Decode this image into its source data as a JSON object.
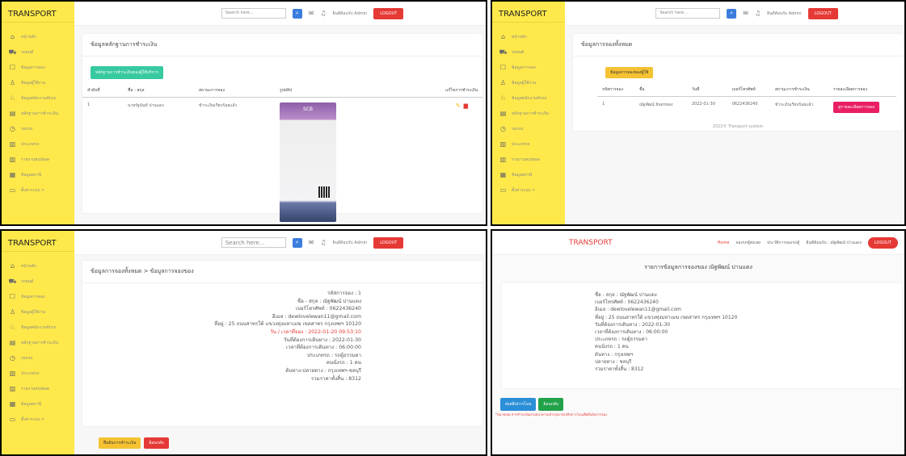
{
  "brand": "TRANSPORT",
  "sidebar_items": [
    {
      "icon": "home-icon",
      "glyph": "⌂",
      "label": "หน้าหลัก"
    },
    {
      "icon": "car-icon",
      "glyph": "⛟",
      "label": "รถยนต์"
    },
    {
      "icon": "booking-icon",
      "glyph": "☐",
      "label": "ข้อมูลการจอง"
    },
    {
      "icon": "user-icon",
      "glyph": "♙",
      "label": "ข้อมูลผู้ใช้งาน"
    },
    {
      "icon": "users-icon",
      "glyph": "♘",
      "label": "ข้อมูลพนักงานขับรถ"
    },
    {
      "icon": "payment-icon",
      "glyph": "▤",
      "label": "หลักฐานการชำระเงิน"
    },
    {
      "icon": "clock-icon",
      "glyph": "◷",
      "label": "รอบรถ"
    },
    {
      "icon": "doc-icon",
      "glyph": "▥",
      "label": "ประเภทรถ"
    },
    {
      "icon": "report-icon",
      "glyph": "▥",
      "label": "รายงานสรุปยอด"
    },
    {
      "icon": "grid-icon",
      "glyph": "▦",
      "label": "ข้อมูลสถานี"
    },
    {
      "icon": "folder-icon",
      "glyph": "▭",
      "label": "ตั้งค่าระบบ  >"
    }
  ],
  "topbar": {
    "search_placeholder": "Search here...",
    "user": "ยินดีต้อนรับ Admin",
    "logout": "LOGOUT"
  },
  "panel1": {
    "title": "ข้อมูลหลักฐานการชำระเงิน",
    "add_button": "หลักฐานการชำระเงินของผู้ใช้บริการ",
    "headers": [
      "ลำดับที่",
      "ชื่อ - สกุล",
      "สถานะการจอง",
      "รูปสลิป",
      "แก้ไขการชำระเงิน"
    ],
    "row": {
      "no": "1",
      "name": "นายรัฐนันท์ ปานแดง",
      "status": "ชำระเงินเรียบร้อยแล้ว",
      "slip_bank": "SCB"
    }
  },
  "panel2": {
    "title": "ข้อมูลการจองทั้งหมด",
    "filter_button": "ข้อมูลการจองของผู้ใช้",
    "headers": [
      "รหัสการจอง",
      "ชื่อ",
      "วันที่",
      "เบอร์โทรศัพท์",
      "สถานะการชำระเงิน",
      "รายละเอียดการจอง"
    ],
    "row": {
      "id": "1",
      "name": "ณัฐพัฒน์ อินทรทอง",
      "date": "2022-01-30",
      "phone": "0622436240",
      "status": "ชำระเงินเรียบร้อยแล้ว",
      "detail_button": "ดูรายละเอียดการจอง"
    },
    "footer": "2022© Transport system"
  },
  "panel3": {
    "breadcrumb": "ข้อมูลการจองทั้งหมด > ข้อมูลการจองของ",
    "lines": [
      "รหัสการจอง : 1",
      "ชื่อ - สกุล : ณัฐพัฒน์ ปานแดง",
      "เบอร์โทรศัพท์ : 0622436240",
      "อีเมล : dewlovelewan11@gmail.com",
      "ที่อยู่ : 25 ถนนสาทรใต้ แขวงทุ่งมหาเมฆ เขตสาทร กรุงเทพฯ 10120",
      "วัน / เวลาที่จอง : 2022-01-20 09:53:10",
      "วันที่ต้องการเดินทาง : 2022-01-30",
      "เวลาที่ต้องการเดินทาง : 06:00:00",
      "ประเภทรถ : รถตู้ธรรมดา",
      "คนนั่งรถ : 1 คน",
      "ต้นทาง-ปลายทาง : กรุงเทพฯ-ชลบุรี",
      "รวมราคาทั้งสิ้น : 8312"
    ],
    "confirm_button": "ยืนยันการชำระเงิน",
    "back_button": "ย้อนกลับ"
  },
  "panel4": {
    "brand": "TRANSPORT",
    "nav": [
      "Home",
      "จองรถตู้ส่งเลย",
      "ประวัติการจองรถตู้",
      "ยินดีต้อนรับ : ณัฐพัฒน์ ปานแดง"
    ],
    "logout": "LOGOUT",
    "heading": "รายการข้อมูลการจองของ ณัฐพัฒน์ ปานแดง",
    "lines": [
      "ชื่อ - สกุล : ณัฐพัฒน์ ปานแดง",
      "เบอร์โทรศัพท์ : 0622436240",
      "อีเมล : dewlovelewan11@gmail.com",
      "ที่อยู่ : 25 ถนนสาทรใต้ แขวงทุ่งมหาเมฆ เขตสาทร กรุงเทพฯ 10120",
      "วันที่ต้องการเดินทาง : 2022-01-30",
      "เวลาที่ต้องการเดินทาง : 06:00:00",
      "ประเภทรถ : รถตู้ธรรมดา",
      "คนนั่งรถ : 1 คน",
      "ต้นทาง : กรุงเทพฯ",
      "ปลายทาง : ชลบุรี",
      "รวมราคาทั้งสิ้น : 8312"
    ],
    "slip_button": "ส่งสลิปการโอน",
    "back_button": "ย้อนกลับ",
    "note": "*หมายเหตุ หากชำระเงินผ่านธนาคารแล้วกรุณาส่งสลิปการโอนเพื่อยืนยันการจอง"
  }
}
